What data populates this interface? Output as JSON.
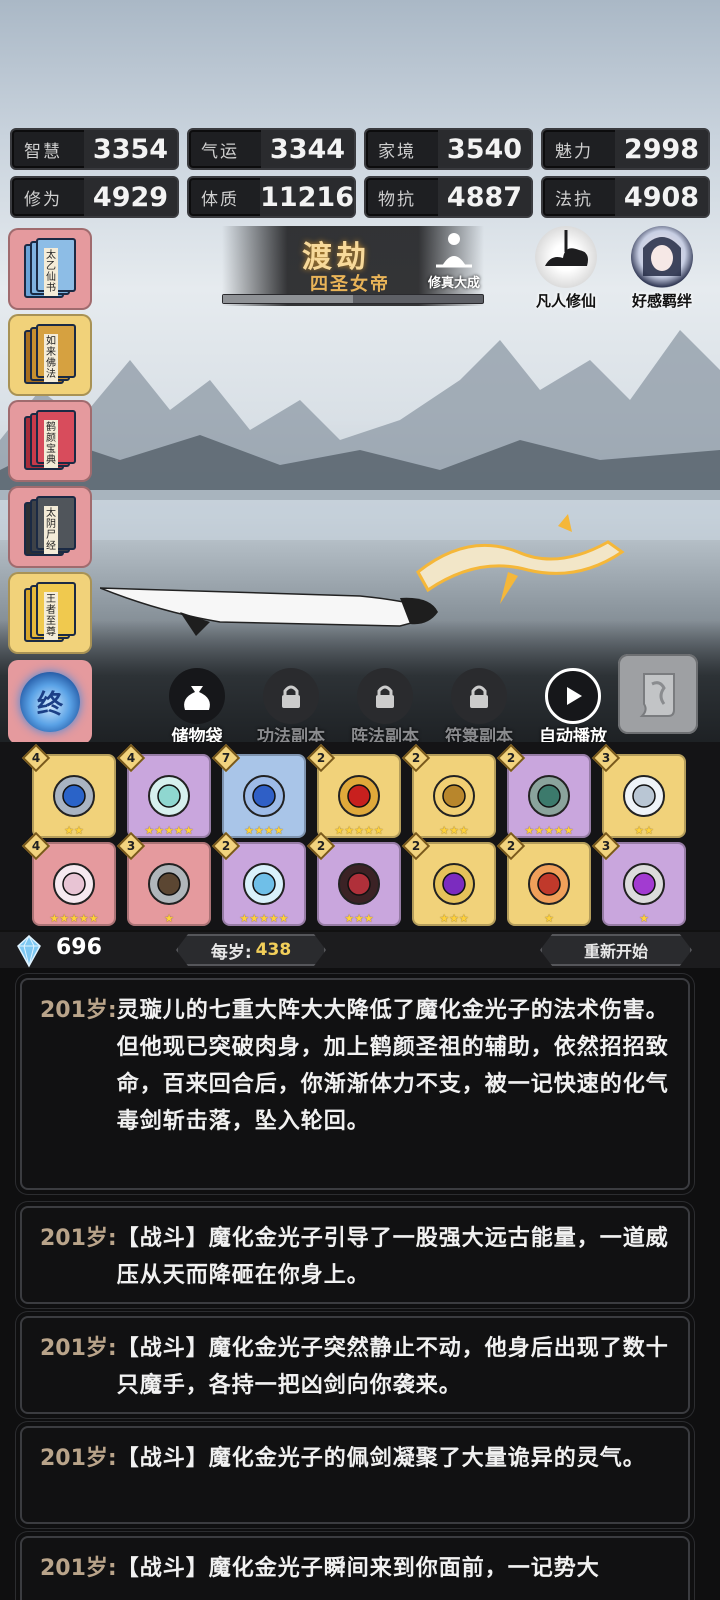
{
  "stats": [
    {
      "label": "智慧",
      "value": "3354"
    },
    {
      "label": "气运",
      "value": "3344"
    },
    {
      "label": "家境",
      "value": "3540"
    },
    {
      "label": "魅力",
      "value": "2998"
    },
    {
      "label": "修为",
      "value": "4929"
    },
    {
      "label": "体质",
      "value": "11216"
    },
    {
      "label": "物抗",
      "value": "4887"
    },
    {
      "label": "法抗",
      "value": "4908"
    }
  ],
  "sidebar": {
    "books": [
      {
        "title": "太乙仙书",
        "color": "red",
        "cover": "#6aa3d8"
      },
      {
        "title": "如来佛法",
        "color": "gold",
        "cover": "#c7902f"
      },
      {
        "title": "鹤颜宝典",
        "color": "red",
        "cover": "#c93a4a"
      },
      {
        "title": "太阴尸经",
        "color": "red",
        "cover": "#3e4247"
      },
      {
        "title": "王者至尊",
        "color": "gold",
        "cover": "#e6b93a"
      }
    ],
    "end_label": "终"
  },
  "realm": {
    "title": "渡劫",
    "subtitle": "四圣女帝",
    "progress": 0.5,
    "icon_label": "修真大成"
  },
  "top_icons": [
    {
      "label": "凡人修仙"
    },
    {
      "label": "好感羁绊"
    }
  ],
  "actions": [
    {
      "label": "储物袋",
      "locked": false,
      "icon": "bag-icon"
    },
    {
      "label": "功法副本",
      "locked": true,
      "icon": "lock-icon"
    },
    {
      "label": "阵法副本",
      "locked": true,
      "icon": "lock-icon"
    },
    {
      "label": "符箓副本",
      "locked": true,
      "icon": "lock-icon"
    },
    {
      "label": "自动播放",
      "locked": false,
      "icon": "play-icon"
    }
  ],
  "inventory": [
    {
      "level": "4",
      "stars": 2,
      "bg": "#f1d27a",
      "art": "blue-orb-amulet"
    },
    {
      "level": "4",
      "stars": 5,
      "bg": "#c9a6dd",
      "art": "jade-pendant"
    },
    {
      "level": "7",
      "stars": 4,
      "bg": "#a9c5e8",
      "art": "boots"
    },
    {
      "level": "2",
      "stars": 5,
      "bg": "#f1d27a",
      "art": "ruby-ring"
    },
    {
      "level": "2",
      "stars": 3,
      "bg": "#f1d27a",
      "art": "dragon-ring"
    },
    {
      "level": "2",
      "stars": 5,
      "bg": "#c9a6dd",
      "art": "hammer"
    },
    {
      "level": "3",
      "stars": 2,
      "bg": "#f1d27a",
      "art": "cloud-orb"
    },
    {
      "level": "4",
      "stars": 5,
      "bg": "#e59a9e",
      "art": "scroll"
    },
    {
      "level": "3",
      "stars": 1,
      "bg": "#e59a9e",
      "art": "axe"
    },
    {
      "level": "2",
      "stars": 5,
      "bg": "#c9a6dd",
      "art": "crystal-ball"
    },
    {
      "level": "2",
      "stars": 3,
      "bg": "#c9a6dd",
      "art": "serpent-ring"
    },
    {
      "level": "2",
      "stars": 3,
      "bg": "#f1d27a",
      "art": "gem-ring"
    },
    {
      "level": "2",
      "stars": 1,
      "bg": "#f1d27a",
      "art": "red-boots"
    },
    {
      "level": "3",
      "stars": 1,
      "bg": "#c9a6dd",
      "art": "sword"
    }
  ],
  "status": {
    "gems": "696",
    "age_label": "每岁:",
    "age_value": "438",
    "restart": "重新开始"
  },
  "log": [
    {
      "age": "201岁:",
      "text": "灵璇儿的七重大阵大大降低了魔化金光子的法术伤害。但他现已突破肉身，加上鹤颜圣祖的辅助，依然招招致命，百来回合后，你渐渐体力不支，被一记快速的化气毒剑斩击落，坠入轮回。"
    },
    {
      "age": "201岁:",
      "text": "【战斗】魔化金光子引导了一股强大远古能量，一道威压从天而降砸在你身上。"
    },
    {
      "age": "201岁:",
      "text": "【战斗】魔化金光子突然静止不动，他身后出现了数十只魔手，各持一把凶剑向你袭来。"
    },
    {
      "age": "201岁:",
      "text": "【战斗】魔化金光子的佩剑凝聚了大量诡异的灵气。"
    },
    {
      "age": "201岁:",
      "text": "【战斗】魔化金光子瞬间来到你面前，一记势大"
    }
  ]
}
